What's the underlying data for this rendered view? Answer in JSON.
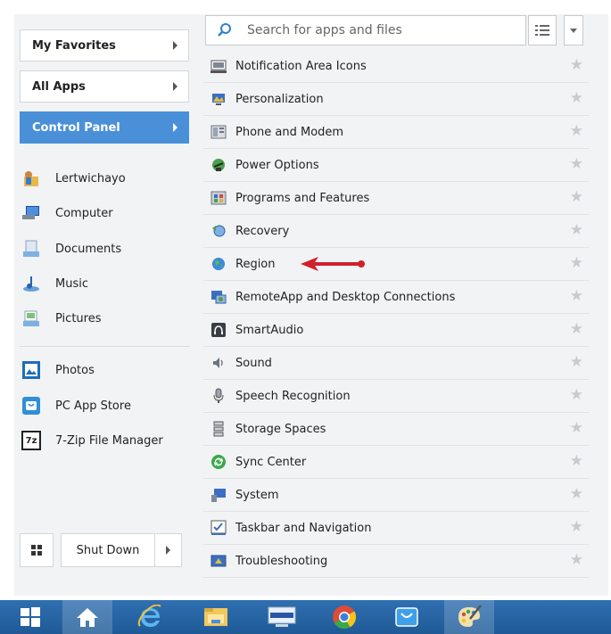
{
  "left_panel": {
    "buttons": [
      {
        "label": "My Favorites",
        "active": false
      },
      {
        "label": "All Apps",
        "active": false
      },
      {
        "label": "Control Panel",
        "active": true
      }
    ],
    "places": [
      {
        "label": "Lertwichayo",
        "icon": "user-folder-icon"
      },
      {
        "label": "Computer",
        "icon": "computer-icon"
      },
      {
        "label": "Documents",
        "icon": "documents-icon"
      },
      {
        "label": "Music",
        "icon": "music-icon"
      },
      {
        "label": "Pictures",
        "icon": "pictures-icon"
      }
    ],
    "apps": [
      {
        "label": "Photos",
        "icon": "photos-icon"
      },
      {
        "label": "PC App Store",
        "icon": "app-store-icon"
      },
      {
        "label": "7-Zip File Manager",
        "icon": "7zip-icon",
        "icon_text": "7z"
      }
    ],
    "shutdown_label": "Shut Down"
  },
  "search": {
    "placeholder": "Search for apps and files"
  },
  "control_panel_items": [
    {
      "label": "Notification Area Icons",
      "icon": "notification-area-icon"
    },
    {
      "label": "Personalization",
      "icon": "personalization-icon"
    },
    {
      "label": "Phone and Modem",
      "icon": "phone-modem-icon"
    },
    {
      "label": "Power Options",
      "icon": "power-options-icon"
    },
    {
      "label": "Programs and Features",
      "icon": "programs-features-icon"
    },
    {
      "label": "Recovery",
      "icon": "recovery-icon"
    },
    {
      "label": "Region",
      "icon": "region-icon",
      "highlighted": true
    },
    {
      "label": "RemoteApp and Desktop Connections",
      "icon": "remoteapp-icon"
    },
    {
      "label": "SmartAudio",
      "icon": "smartaudio-icon"
    },
    {
      "label": "Sound",
      "icon": "sound-icon"
    },
    {
      "label": "Speech Recognition",
      "icon": "speech-recognition-icon"
    },
    {
      "label": "Storage Spaces",
      "icon": "storage-spaces-icon"
    },
    {
      "label": "Sync Center",
      "icon": "sync-center-icon"
    },
    {
      "label": "System",
      "icon": "system-icon"
    },
    {
      "label": "Taskbar and Navigation",
      "icon": "taskbar-navigation-icon"
    },
    {
      "label": "Troubleshooting",
      "icon": "troubleshooting-icon"
    }
  ],
  "taskbar": {
    "icons": [
      "windows-start-icon",
      "home-icon",
      "internet-explorer-icon",
      "file-explorer-icon",
      "lenovo-icon",
      "chrome-icon",
      "store-icon",
      "paint-icon"
    ],
    "lenovo_text": "lenovo"
  },
  "colors": {
    "accent": "#4a90d9",
    "annotation_arrow": "#d0202a",
    "taskbar": "#2a66a6"
  }
}
